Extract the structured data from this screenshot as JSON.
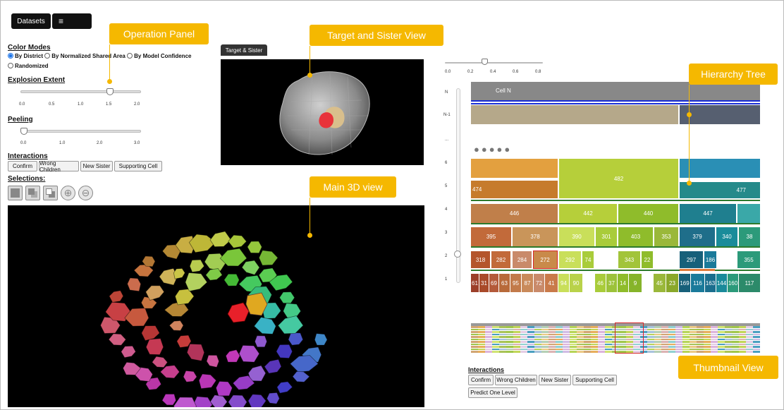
{
  "toolbar": {
    "datasets_label": "Datasets",
    "menu_icon": "hamburger-icon"
  },
  "operation_panel": {
    "color_modes": {
      "title": "Color Modes",
      "options": [
        "By District",
        "By Normalized Shared Area",
        "By Model Confidence",
        "Randomized"
      ],
      "selected": "By District"
    },
    "explosion": {
      "title": "Explosion Extent",
      "ticks": [
        "0.0",
        "0.5",
        "1.0",
        "1.5",
        "2.0"
      ],
      "value": 1.5
    },
    "peeling": {
      "title": "Peeling",
      "ticks": [
        "0.0",
        "1.0",
        "2.0",
        "3.0"
      ],
      "value": 0.0
    },
    "interactions": {
      "title": "Interactions",
      "buttons": [
        "Confirm",
        "Wrong Children",
        "New Sister",
        "Supporting Cell"
      ]
    },
    "selections": {
      "title": "Selections:",
      "icons": [
        "select-all-icon",
        "select-subset-icon",
        "select-copy-icon",
        "zoom-in-icon",
        "zoom-out-icon"
      ]
    }
  },
  "target_view": {
    "tab_label": "Target & Sister"
  },
  "tree_view": {
    "slider_ticks": [
      "0.0",
      "0.2",
      "0.4",
      "0.6",
      "0.8"
    ],
    "slider_value": 0.4,
    "y_labels": [
      "N",
      "N-1",
      "...",
      "6",
      "5",
      "4",
      "3",
      "2",
      "1"
    ],
    "cell_n_label": "Cell N",
    "row5": [
      "474",
      "482",
      "477"
    ],
    "row4": [
      "446",
      "442",
      "440",
      "447"
    ],
    "row3": [
      "395",
      "378",
      "390",
      "301",
      "403",
      "353",
      "379",
      "340",
      "38"
    ],
    "row2": [
      "318",
      "282",
      "284",
      "272",
      "292",
      "74",
      "343",
      "22",
      "297",
      "186",
      "355"
    ],
    "row1": [
      "61",
      "31",
      "69",
      "63",
      "95",
      "87",
      "72",
      "41",
      "94",
      "90",
      "46",
      "37",
      "14",
      "9",
      "45",
      "23",
      "169",
      "116",
      "163",
      "144",
      "160",
      "117"
    ]
  },
  "bottom_panel": {
    "title": "Interactions",
    "buttons": [
      "Confirm",
      "Wrong Children",
      "New Sister",
      "Supporting Cell"
    ],
    "predict_label": "Predict One Level"
  },
  "callouts": {
    "operation_panel": "Operation Panel",
    "target_sister": "Target and Sister View",
    "main_3d": "Main 3D view",
    "hierarchy": "Hierarchy Tree",
    "thumbnail": "Thumbnail View"
  },
  "colors": {
    "callout": "#f5b800",
    "selected_block": "#d62728"
  }
}
